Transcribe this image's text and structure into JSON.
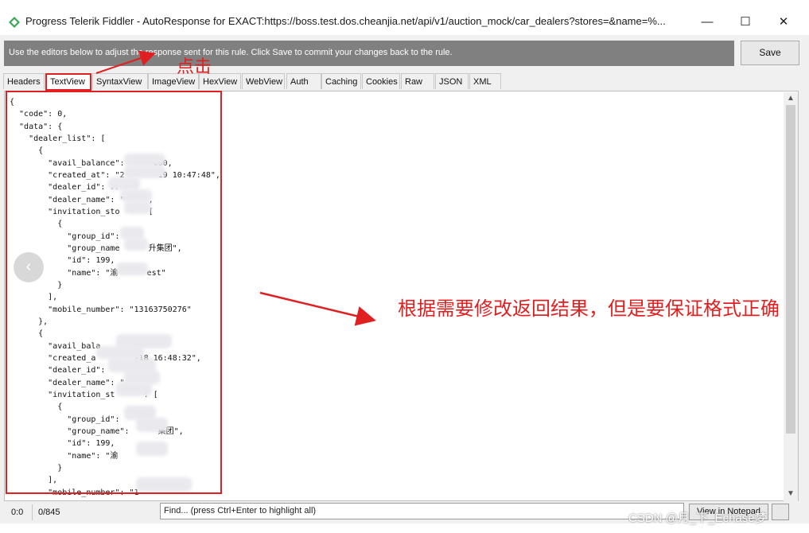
{
  "window": {
    "title": "Progress Telerik Fiddler - AutoResponse for EXACT:https://boss.test.dos.cheanjia.net/api/v1/auction_mock/car_dealers?stores=&name=%...",
    "min_symbol": "—",
    "max_symbol": "☐",
    "close_symbol": "✕"
  },
  "infobar": {
    "message": "Use the editors below to adjust the response sent for this rule. Click Save to commit your changes back to the rule.",
    "save_label": "Save"
  },
  "tabs": [
    {
      "label": "Headers"
    },
    {
      "label": "TextView",
      "active": true
    },
    {
      "label": "SyntaxView"
    },
    {
      "label": "ImageView"
    },
    {
      "label": "HexView"
    },
    {
      "label": "WebView"
    },
    {
      "label": "Auth"
    },
    {
      "label": "Caching"
    },
    {
      "label": "Cookies"
    },
    {
      "label": "Raw"
    },
    {
      "label": "JSON"
    },
    {
      "label": "XML"
    }
  ],
  "editor": {
    "body": "{\n  \"code\": 0,\n  \"data\": {\n    \"dealer_list\": [\n      {\n        \"avail_balance\":      000,\n        \"created_at\": \"2      -19 10:47:48\",\n        \"dealer_id\": 77\n        \"dealer_name\": \"    \",\n        \"invitation_sto      [\n          {\n            \"group_id\":\n            \"group_name      升集团\",\n            \"id\": 199,\n            \"name\": \"渝      est\"\n          }\n        ],\n        \"mobile_number\": \"13163750276\"\n      },\n      {\n        \"avail_bala\n        \"created_a        -18 16:48:32\",\n        \"dealer_id\":\n        \"dealer_name\": \"\n        \"invitation_st      : [\n          {\n            \"group_id\":\n            \"group_name\":      集团\",\n            \"id\": 199,\n            \"name\": \"渝\n          }\n        ],\n        \"mobile_number\": \"1"
  },
  "annotations": {
    "click_label": "点击",
    "instruction": "根据需要修改返回结果，但是要保证格式正确"
  },
  "statusbar": {
    "position": "0:0",
    "count": "0/845",
    "find_placeholder": "Find... (press Ctrl+Enter to highlight all)",
    "notepad_label": "View in Notepad"
  },
  "watermark": "CSDN @月_下_Echase梦",
  "colors": {
    "annotation": "#e02020",
    "infobar": "#808080"
  }
}
